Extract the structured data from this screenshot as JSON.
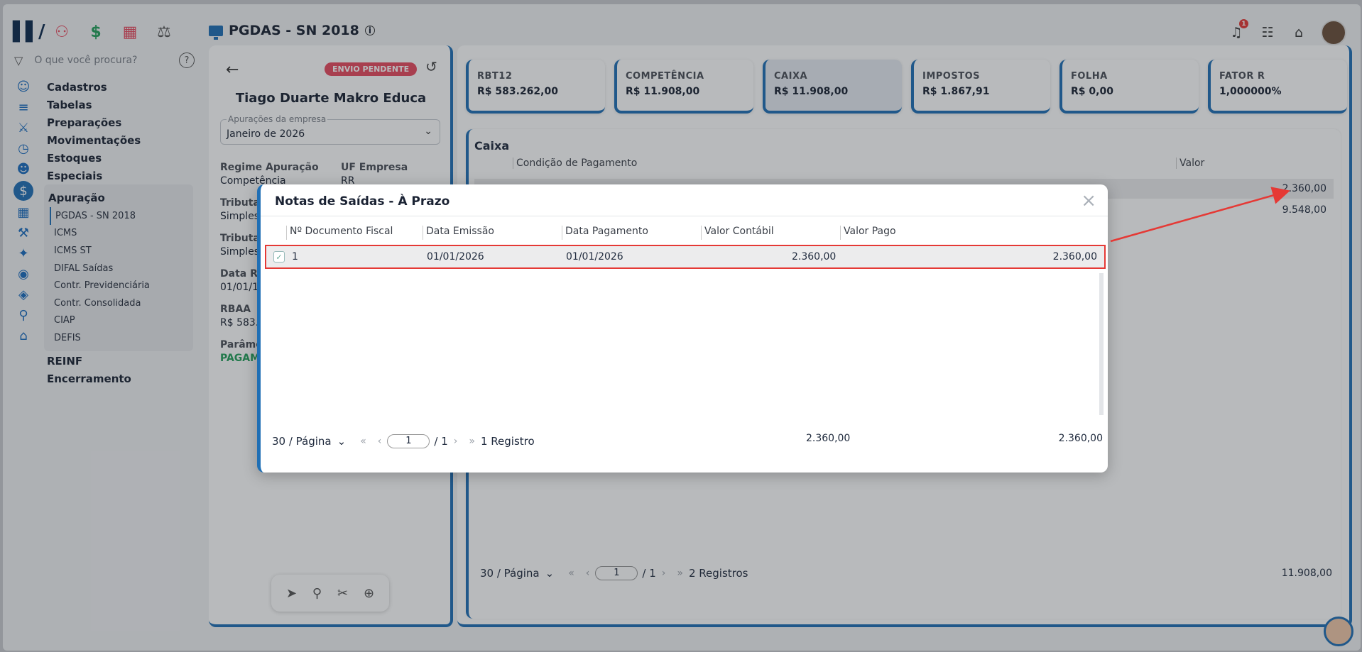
{
  "header": {
    "title": "PGDAS - SN 2018",
    "notifications_count": "1"
  },
  "sidebar": {
    "search_placeholder": "O que você procura?",
    "items": [
      {
        "label": "Cadastros"
      },
      {
        "label": "Tabelas"
      },
      {
        "label": "Preparações"
      },
      {
        "label": "Movimentações"
      },
      {
        "label": "Estoques"
      },
      {
        "label": "Especiais"
      }
    ],
    "apuracao": {
      "label": "Apuração",
      "subitems": [
        "PGDAS - SN 2018",
        "ICMS",
        "ICMS ST",
        "DIFAL Saídas",
        "Contr. Previdenciária",
        "Contr. Consolidada",
        "CIAP",
        "DEFIS"
      ]
    },
    "after_items": [
      {
        "label": "REINF"
      },
      {
        "label": "Encerramento"
      }
    ]
  },
  "company": {
    "status_badge": "ENVIO PENDENTE",
    "name": "Tiago Duarte Makro Educa",
    "select_label": "Apurações da empresa",
    "select_value": "Janeiro de 2026",
    "regime_label": "Regime Apuração",
    "regime_value": "Competência",
    "uf_label": "UF Empresa",
    "uf_value": "RR",
    "trib1_label": "Tributa",
    "trib1_value": "Simples",
    "trib2_label": "Tributa",
    "trib2_value": "Simples",
    "data_label": "Data Re",
    "data_value": "01/01/19",
    "rbaa_label": "RBAA",
    "rbaa_value": "R$ 583.",
    "param_label": "Parâme",
    "param_value": "PAGAM"
  },
  "cards": [
    {
      "title": "RBT12",
      "value": "R$ 583.262,00"
    },
    {
      "title": "COMPETÊNCIA",
      "value": "R$ 11.908,00"
    },
    {
      "title": "CAIXA",
      "value": "R$ 11.908,00"
    },
    {
      "title": "IMPOSTOS",
      "value": "R$ 1.867,91"
    },
    {
      "title": "FOLHA",
      "value": "R$ 0,00"
    },
    {
      "title": "FATOR R",
      "value": "1,000000%"
    }
  ],
  "caixa": {
    "title": "Caixa",
    "col_condicao": "Condição de Pagamento",
    "col_valor": "Valor",
    "rows": [
      {
        "valor": "2.360,00"
      },
      {
        "valor": "9.548,00"
      }
    ],
    "page_size": "30 / Página",
    "page_current": "1",
    "page_total": "/ 1",
    "records": "2 Registros",
    "total": "11.908,00"
  },
  "modal": {
    "title": "Notas de Saídas - À Prazo",
    "columns": [
      "Nº Documento Fiscal",
      "Data Emissão",
      "Data Pagamento",
      "Valor Contábil",
      "Valor Pago"
    ],
    "row": {
      "doc": "1",
      "emissao": "01/01/2026",
      "pagamento": "01/01/2026",
      "contabil": "2.360,00",
      "pago": "2.360,00"
    },
    "page_size": "30 / Página",
    "page_current": "1",
    "page_total": "/ 1",
    "records": "1 Registro",
    "total_contabil": "2.360,00",
    "total_pago": "2.360,00"
  },
  "colors": {
    "accent": "#1f6fb5",
    "badge": "#e84a5f",
    "highlight": "#e53935"
  }
}
